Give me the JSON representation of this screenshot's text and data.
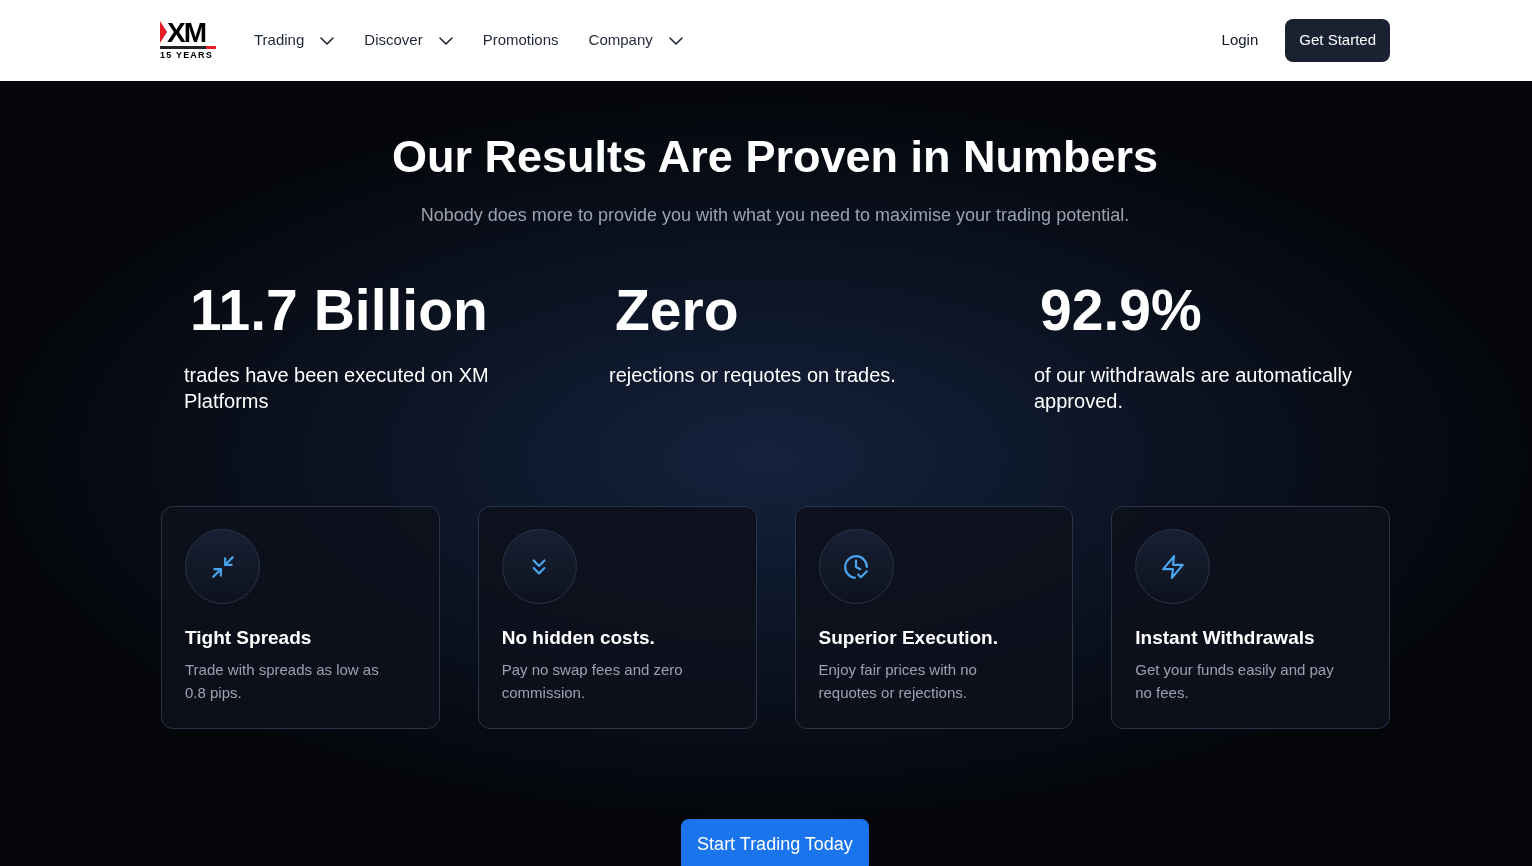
{
  "header": {
    "logo": {
      "mark": "XM",
      "tagline": "15 YEARS"
    },
    "nav": [
      {
        "label": "Trading",
        "dropdown": true
      },
      {
        "label": "Discover",
        "dropdown": true
      },
      {
        "label": "Promotions",
        "dropdown": false
      },
      {
        "label": "Company",
        "dropdown": true
      }
    ],
    "login": "Login",
    "cta": "Get Started"
  },
  "hero": {
    "title": "Our Results Are Proven in Numbers",
    "subtitle": "Nobody does more to provide you with what you need to maximise your trading potential."
  },
  "stats": [
    {
      "value": "11.7 Billion",
      "description": "trades have been executed on XM Platforms"
    },
    {
      "value": "Zero",
      "description": "rejections or requotes on trades."
    },
    {
      "value": "92.9%",
      "description": "of our withdrawals are automatically approved."
    }
  ],
  "features": [
    {
      "kind": "spreads",
      "title": "Tight Spreads",
      "description": "Trade with spreads as low as 0.8 pips."
    },
    {
      "kind": "costs",
      "title": "No hidden costs.",
      "description": "Pay no swap fees and zero commission."
    },
    {
      "kind": "execution",
      "title": "Superior Execution.",
      "description": "Enjoy fair prices with no requotes or rejections."
    },
    {
      "kind": "withdrawals",
      "title": "Instant Withdrawals",
      "description": "Get your funds easily and pay no fees."
    }
  ],
  "cta": "Start Trading Today"
}
